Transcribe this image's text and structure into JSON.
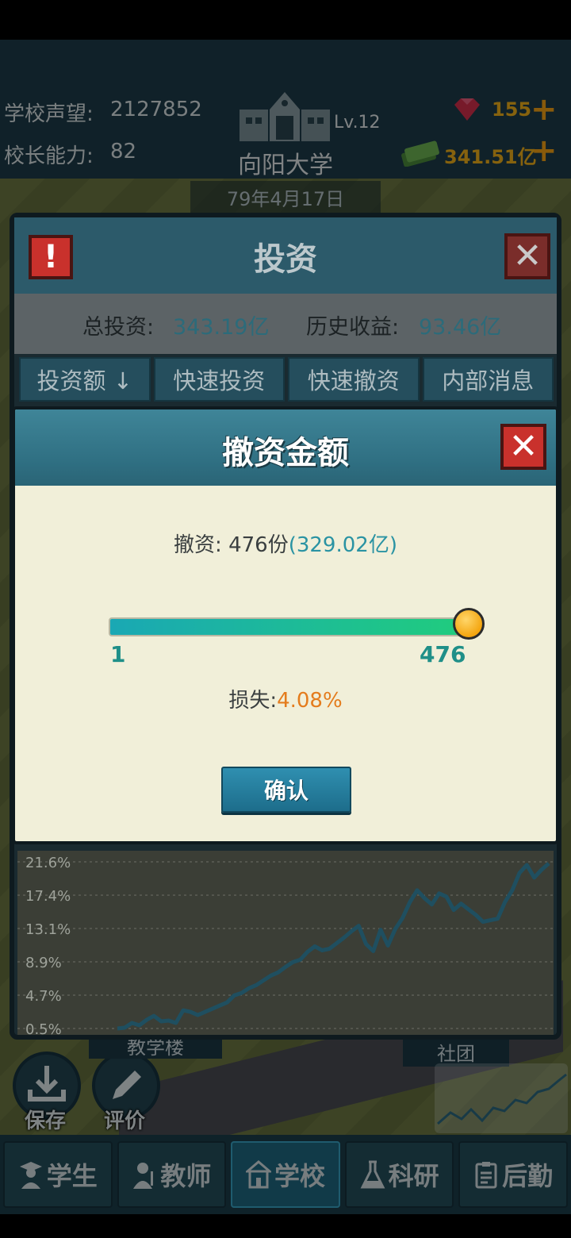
{
  "hud": {
    "prestige_label": "学校声望:",
    "prestige_value": "2127852",
    "principal_label": "校长能力:",
    "principal_value": "82",
    "school_name": "向阳大学",
    "school_level": "Lv.12",
    "gems": "155",
    "cash": "341.51亿",
    "date": "79年4月17日"
  },
  "map": {
    "save_label": "保存",
    "review_label": "评价",
    "building_label": "教学楼",
    "club_label": "社团"
  },
  "invest_panel": {
    "title": "投资",
    "alert_icon": "!",
    "total_label": "总投资:",
    "total_value": "343.19亿",
    "history_label": "历史收益:",
    "history_value": "93.46亿",
    "tabs": [
      {
        "label": "投资额 ↓"
      },
      {
        "label": "快速投资"
      },
      {
        "label": "快速撤资"
      },
      {
        "label": "内部消息"
      }
    ],
    "chart_y_ticks": [
      "21.6%",
      "17.4%",
      "13.1%",
      "8.9%",
      "4.7%",
      "0.5%"
    ]
  },
  "withdraw_dialog": {
    "title": "撤资金额",
    "withdraw_label": "撤资:",
    "shares": "476份",
    "amount": "(329.02亿)",
    "slider_min": "1",
    "slider_max": "476",
    "slider_value_fraction": 1.0,
    "loss_label": "损失:",
    "loss_value": "4.08%",
    "confirm_label": "确认"
  },
  "bottom_nav": {
    "tabs": [
      {
        "label": "学生",
        "icon": "student-icon"
      },
      {
        "label": "教师",
        "icon": "teacher-icon"
      },
      {
        "label": "学校",
        "icon": "school-icon"
      },
      {
        "label": "科研",
        "icon": "flask-icon"
      },
      {
        "label": "后勤",
        "icon": "clipboard-icon"
      }
    ],
    "active_index": 2
  },
  "chart_data": {
    "type": "line",
    "y_ticks": [
      "21.6%",
      "17.4%",
      "13.1%",
      "8.9%",
      "4.7%",
      "0.5%"
    ],
    "ylim": [
      0.5,
      21.6
    ],
    "values": [
      0.5,
      0.6,
      1.2,
      0.9,
      1.6,
      2.1,
      1.4,
      1.5,
      1.2,
      2.8,
      2.6,
      2.2,
      2.6,
      3.0,
      3.4,
      3.8,
      4.7,
      5.0,
      5.6,
      6.0,
      6.6,
      7.2,
      7.6,
      8.3,
      8.9,
      9.2,
      10.2,
      10.9,
      10.4,
      10.6,
      11.3,
      12.0,
      12.8,
      13.5,
      11.2,
      10.3,
      13.0,
      11.0,
      13.1,
      14.5,
      16.5,
      18.0,
      17.0,
      16.2,
      17.6,
      17.2,
      15.5,
      16.3,
      15.6,
      14.9,
      14.0,
      14.2,
      14.4,
      16.5,
      18.0,
      20.2,
      21.2,
      19.6,
      20.6,
      21.4
    ]
  }
}
